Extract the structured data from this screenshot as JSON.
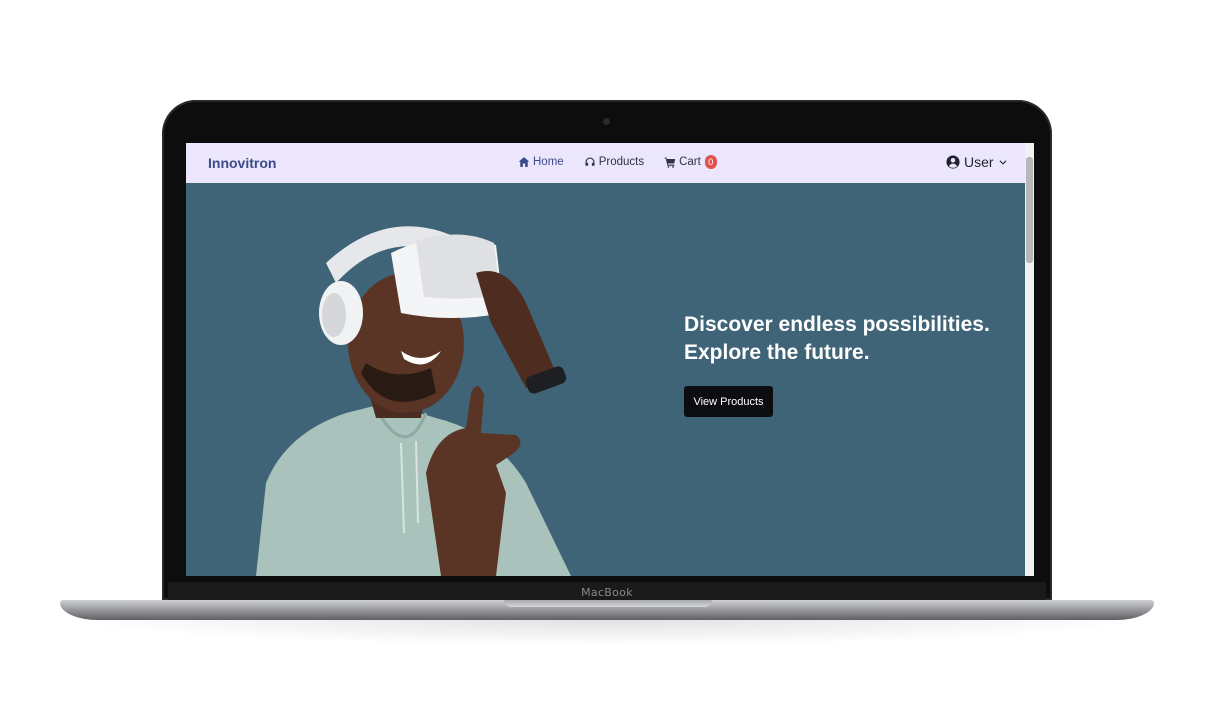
{
  "device": {
    "brand_label": "MacBook"
  },
  "navbar": {
    "logo": "Innovitron",
    "links": [
      {
        "label": "Home",
        "icon": "home-icon"
      },
      {
        "label": "Products",
        "icon": "headphones-icon"
      },
      {
        "label": "Cart",
        "icon": "cart-icon",
        "badge": "0"
      }
    ],
    "user_label": "User"
  },
  "hero": {
    "heading_line1": "Discover endless possibilities.",
    "heading_line2": "Explore the future.",
    "button_label": "View Products",
    "image_subject": "person-wearing-vr-headset"
  },
  "colors": {
    "navbar_bg": "#ebe6fb",
    "hero_bg": "#3f6478",
    "logo": "#3b4a8a",
    "button_bg": "#0c0d10",
    "badge_bg": "#e0524f"
  }
}
